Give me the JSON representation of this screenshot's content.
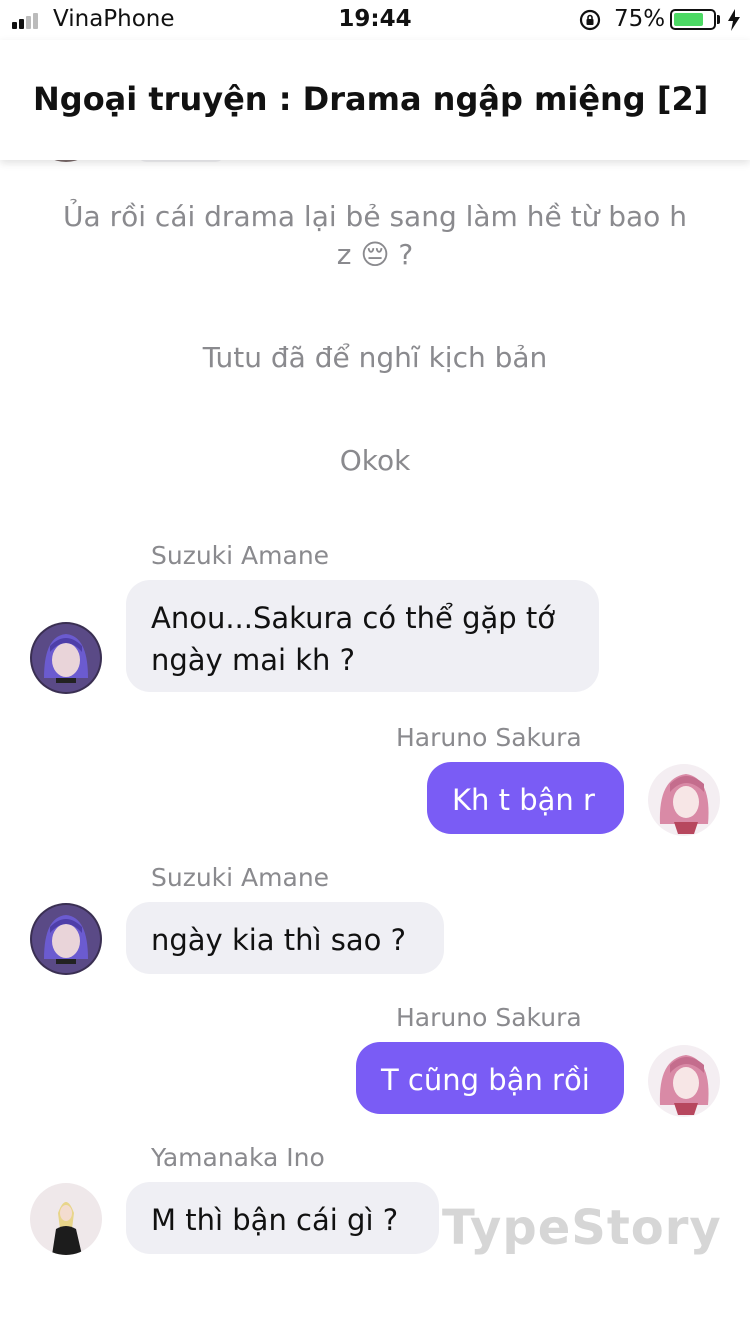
{
  "status_bar": {
    "carrier": "VinaPhone",
    "time": "19:44",
    "battery_percent": "75%",
    "battery_level": 0.75,
    "battery_color": "#4cd964"
  },
  "header": {
    "title": "Ngoại truyện : Drama ngập miệng [2]"
  },
  "narrations": [
    {
      "text": "Ủa rồi cái drama lại bẻ sang làm hề từ bao h z 😔 ?"
    },
    {
      "text": "Tutu đã để nghĩ kịch bản"
    },
    {
      "text": "Okok"
    }
  ],
  "messages": [
    {
      "sender": "Suzuki Amane",
      "text": "Anou...Sakura có thể gặp tớ ngày mai kh ?",
      "side": "left",
      "avatar_icon": "purple-hair-avatar"
    },
    {
      "sender": "Haruno Sakura",
      "text": "Kh t bận r",
      "side": "right",
      "avatar_icon": "pink-hair-avatar"
    },
    {
      "sender": "Suzuki Amane",
      "text": "ngày kia thì sao ?",
      "side": "left",
      "avatar_icon": "purple-hair-avatar"
    },
    {
      "sender": "Haruno Sakura",
      "text": "T cũng bận rồi",
      "side": "right",
      "avatar_icon": "pink-hair-avatar"
    },
    {
      "sender": "Yamanaka Ino",
      "text": "M thì bận cái gì ?",
      "side": "left",
      "avatar_icon": "blonde-hair-avatar"
    }
  ],
  "colors": {
    "outgoing_bubble": "#7a5cf5",
    "incoming_bubble": "#efeff4",
    "name_text": "#8a8a8e"
  },
  "watermark": "TypeStory"
}
